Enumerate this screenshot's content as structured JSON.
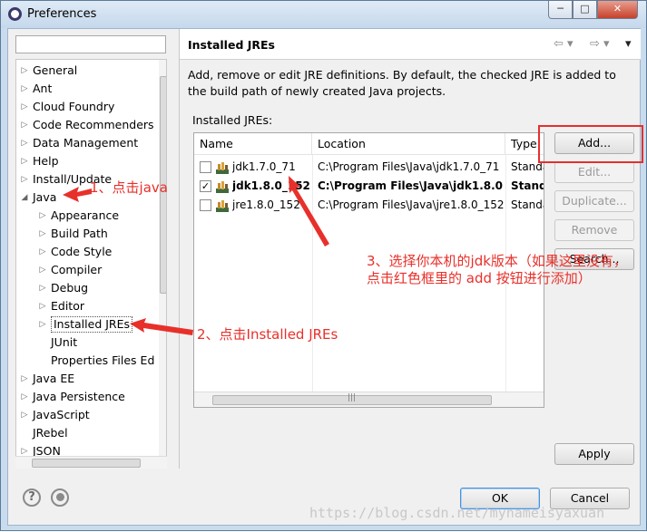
{
  "window": {
    "title": "Preferences",
    "min": "─",
    "max": "□",
    "close": "✕"
  },
  "filter": {
    "value": "",
    "placeholder": ""
  },
  "tree": {
    "items": [
      {
        "label": "General",
        "expand": "▷"
      },
      {
        "label": "Ant",
        "expand": "▷"
      },
      {
        "label": "Cloud Foundry",
        "expand": "▷"
      },
      {
        "label": "Code Recommenders",
        "expand": "▷"
      },
      {
        "label": "Data Management",
        "expand": "▷"
      },
      {
        "label": "Help",
        "expand": "▷"
      },
      {
        "label": "Install/Update",
        "expand": "▷"
      },
      {
        "label": "Java",
        "expand": "◢"
      },
      {
        "label": "Appearance",
        "expand": "▷"
      },
      {
        "label": "Build Path",
        "expand": "▷"
      },
      {
        "label": "Code Style",
        "expand": "▷"
      },
      {
        "label": "Compiler",
        "expand": "▷"
      },
      {
        "label": "Debug",
        "expand": "▷"
      },
      {
        "label": "Editor",
        "expand": "▷"
      },
      {
        "label": "Installed JREs",
        "expand": "▷"
      },
      {
        "label": "JUnit",
        "expand": ""
      },
      {
        "label": "Properties Files Ed",
        "expand": ""
      },
      {
        "label": "Java EE",
        "expand": "▷"
      },
      {
        "label": "Java Persistence",
        "expand": "▷"
      },
      {
        "label": "JavaScript",
        "expand": "▷"
      },
      {
        "label": "JRebel",
        "expand": ""
      },
      {
        "label": "JSON",
        "expand": "▷"
      }
    ]
  },
  "pane": {
    "title": "Installed JREs",
    "nav_back": "⇦ ▾",
    "nav_fwd": "⇨ ▾",
    "nav_menu": "▾",
    "description": "Add, remove or edit JRE definitions. By default, the checked JRE is added to the build path of newly created Java projects.",
    "jres_label": "Installed JREs:",
    "columns": [
      "Name",
      "Location",
      "Type"
    ],
    "rows": [
      {
        "checked": "",
        "name": "jdk1.7.0_71",
        "location": "C:\\Program Files\\Java\\jdk1.7.0_71",
        "type": "Standa"
      },
      {
        "checked": "✓",
        "name": "jdk1.8.0_152...",
        "location": "C:\\Program Files\\Java\\jdk1.8.0...",
        "type": "Stand"
      },
      {
        "checked": "",
        "name": "jre1.8.0_152",
        "location": "C:\\Program Files\\Java\\jre1.8.0_152",
        "type": "Standa"
      }
    ],
    "scroll_grip": "|||",
    "buttons": {
      "add": "Add...",
      "edit": "Edit...",
      "duplicate": "Duplicate...",
      "remove": "Remove",
      "search": "Search..."
    },
    "apply": "Apply"
  },
  "footer": {
    "help": "?",
    "ok": "OK",
    "cancel": "Cancel"
  },
  "annotations": {
    "a1": "1、点击java",
    "a2": "2、点击Installed JREs",
    "a3_line1": "3、选择你本机的jdk版本（如果这里没有，",
    "a3_line2": "点击红色框里的  add  按钮进行添加）"
  },
  "watermark": "https://blog.csdn.net/mynameisyaxuan",
  "colors": {
    "annotation": "#e8302a",
    "titlebar": "#c9dced",
    "close": "#c7412b"
  }
}
